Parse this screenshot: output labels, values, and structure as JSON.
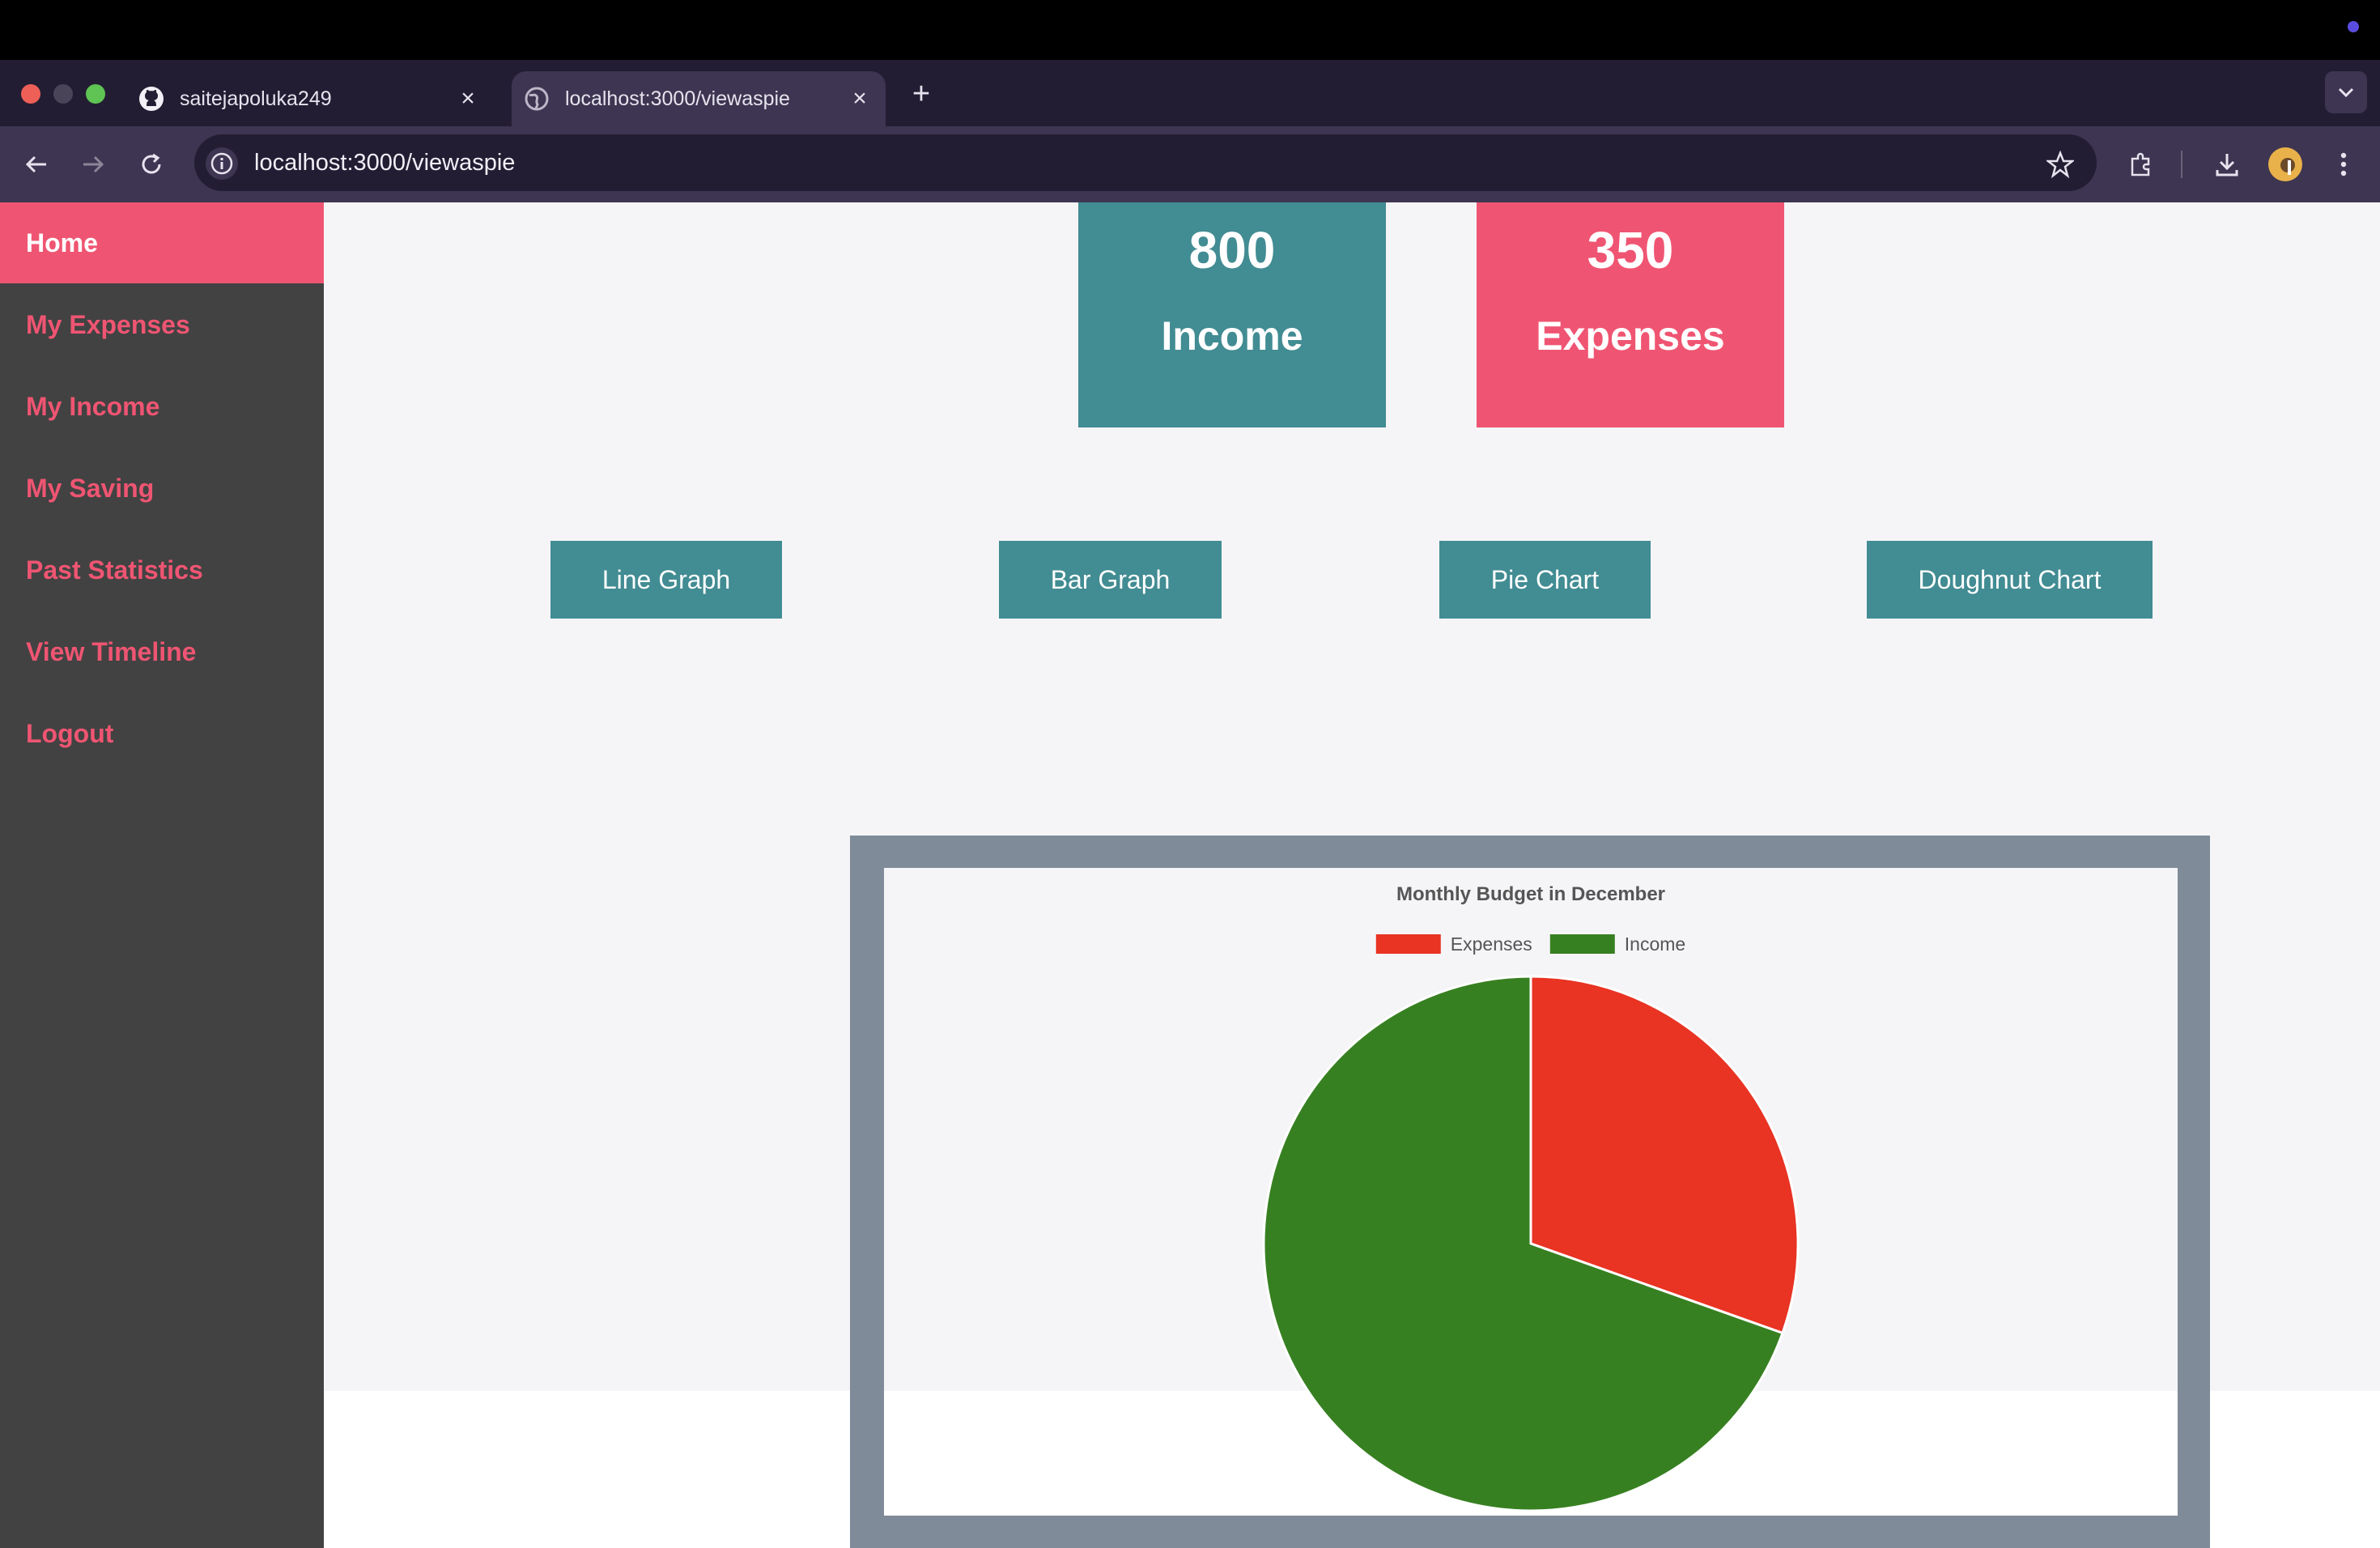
{
  "browser": {
    "tabs": [
      {
        "title": "saitejapoluka249",
        "icon": "github-icon",
        "active": false
      },
      {
        "title": "localhost:3000/viewaspie",
        "icon": "globe-icon",
        "active": true
      }
    ],
    "url": "localhost:3000/viewaspie"
  },
  "sidebar": {
    "items": [
      {
        "label": "Home",
        "active": true
      },
      {
        "label": "My Expenses"
      },
      {
        "label": "My Income"
      },
      {
        "label": "My Saving"
      },
      {
        "label": "Past Statistics"
      },
      {
        "label": "View Timeline"
      },
      {
        "label": "Logout"
      }
    ]
  },
  "summary": {
    "income": {
      "value": "800",
      "label": "Income",
      "color": "#428c93"
    },
    "expenses": {
      "value": "350",
      "label": "Expenses",
      "color": "#ef5572"
    }
  },
  "graph_buttons": {
    "line": "Line Graph",
    "bar": "Bar Graph",
    "pie": "Pie Chart",
    "doughnut": "Doughnut Chart"
  },
  "colors": {
    "accent": "#ef5572",
    "teal": "#428c93",
    "sidebar": "#424242",
    "expenses_slice": "#e93323",
    "income_slice": "#378021"
  },
  "chart_data": {
    "type": "pie",
    "title": "Monthly Budget in December",
    "categories": [
      "Expenses",
      "Income"
    ],
    "values": [
      350,
      800
    ],
    "colors": [
      "#e93323",
      "#378021"
    ],
    "legend": "top"
  }
}
